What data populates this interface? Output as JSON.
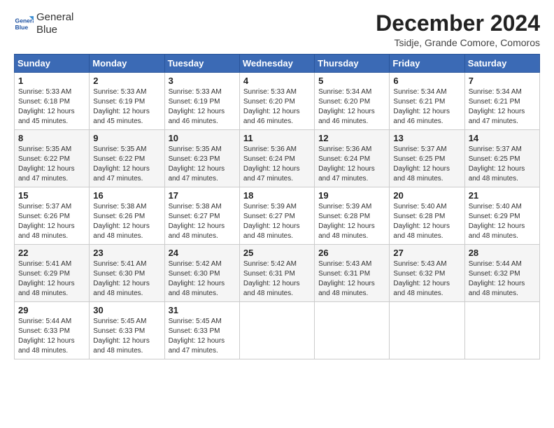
{
  "logo": {
    "line1": "General",
    "line2": "Blue"
  },
  "title": "December 2024",
  "subtitle": "Tsidje, Grande Comore, Comoros",
  "days_header": [
    "Sunday",
    "Monday",
    "Tuesday",
    "Wednesday",
    "Thursday",
    "Friday",
    "Saturday"
  ],
  "weeks": [
    [
      {
        "day": "1",
        "sunrise": "5:33 AM",
        "sunset": "6:18 PM",
        "daylight": "12 hours and 45 minutes."
      },
      {
        "day": "2",
        "sunrise": "5:33 AM",
        "sunset": "6:19 PM",
        "daylight": "12 hours and 45 minutes."
      },
      {
        "day": "3",
        "sunrise": "5:33 AM",
        "sunset": "6:19 PM",
        "daylight": "12 hours and 46 minutes."
      },
      {
        "day": "4",
        "sunrise": "5:33 AM",
        "sunset": "6:20 PM",
        "daylight": "12 hours and 46 minutes."
      },
      {
        "day": "5",
        "sunrise": "5:34 AM",
        "sunset": "6:20 PM",
        "daylight": "12 hours and 46 minutes."
      },
      {
        "day": "6",
        "sunrise": "5:34 AM",
        "sunset": "6:21 PM",
        "daylight": "12 hours and 46 minutes."
      },
      {
        "day": "7",
        "sunrise": "5:34 AM",
        "sunset": "6:21 PM",
        "daylight": "12 hours and 47 minutes."
      }
    ],
    [
      {
        "day": "8",
        "sunrise": "5:35 AM",
        "sunset": "6:22 PM",
        "daylight": "12 hours and 47 minutes."
      },
      {
        "day": "9",
        "sunrise": "5:35 AM",
        "sunset": "6:22 PM",
        "daylight": "12 hours and 47 minutes."
      },
      {
        "day": "10",
        "sunrise": "5:35 AM",
        "sunset": "6:23 PM",
        "daylight": "12 hours and 47 minutes."
      },
      {
        "day": "11",
        "sunrise": "5:36 AM",
        "sunset": "6:24 PM",
        "daylight": "12 hours and 47 minutes."
      },
      {
        "day": "12",
        "sunrise": "5:36 AM",
        "sunset": "6:24 PM",
        "daylight": "12 hours and 47 minutes."
      },
      {
        "day": "13",
        "sunrise": "5:37 AM",
        "sunset": "6:25 PM",
        "daylight": "12 hours and 48 minutes."
      },
      {
        "day": "14",
        "sunrise": "5:37 AM",
        "sunset": "6:25 PM",
        "daylight": "12 hours and 48 minutes."
      }
    ],
    [
      {
        "day": "15",
        "sunrise": "5:37 AM",
        "sunset": "6:26 PM",
        "daylight": "12 hours and 48 minutes."
      },
      {
        "day": "16",
        "sunrise": "5:38 AM",
        "sunset": "6:26 PM",
        "daylight": "12 hours and 48 minutes."
      },
      {
        "day": "17",
        "sunrise": "5:38 AM",
        "sunset": "6:27 PM",
        "daylight": "12 hours and 48 minutes."
      },
      {
        "day": "18",
        "sunrise": "5:39 AM",
        "sunset": "6:27 PM",
        "daylight": "12 hours and 48 minutes."
      },
      {
        "day": "19",
        "sunrise": "5:39 AM",
        "sunset": "6:28 PM",
        "daylight": "12 hours and 48 minutes."
      },
      {
        "day": "20",
        "sunrise": "5:40 AM",
        "sunset": "6:28 PM",
        "daylight": "12 hours and 48 minutes."
      },
      {
        "day": "21",
        "sunrise": "5:40 AM",
        "sunset": "6:29 PM",
        "daylight": "12 hours and 48 minutes."
      }
    ],
    [
      {
        "day": "22",
        "sunrise": "5:41 AM",
        "sunset": "6:29 PM",
        "daylight": "12 hours and 48 minutes."
      },
      {
        "day": "23",
        "sunrise": "5:41 AM",
        "sunset": "6:30 PM",
        "daylight": "12 hours and 48 minutes."
      },
      {
        "day": "24",
        "sunrise": "5:42 AM",
        "sunset": "6:30 PM",
        "daylight": "12 hours and 48 minutes."
      },
      {
        "day": "25",
        "sunrise": "5:42 AM",
        "sunset": "6:31 PM",
        "daylight": "12 hours and 48 minutes."
      },
      {
        "day": "26",
        "sunrise": "5:43 AM",
        "sunset": "6:31 PM",
        "daylight": "12 hours and 48 minutes."
      },
      {
        "day": "27",
        "sunrise": "5:43 AM",
        "sunset": "6:32 PM",
        "daylight": "12 hours and 48 minutes."
      },
      {
        "day": "28",
        "sunrise": "5:44 AM",
        "sunset": "6:32 PM",
        "daylight": "12 hours and 48 minutes."
      }
    ],
    [
      {
        "day": "29",
        "sunrise": "5:44 AM",
        "sunset": "6:33 PM",
        "daylight": "12 hours and 48 minutes."
      },
      {
        "day": "30",
        "sunrise": "5:45 AM",
        "sunset": "6:33 PM",
        "daylight": "12 hours and 48 minutes."
      },
      {
        "day": "31",
        "sunrise": "5:45 AM",
        "sunset": "6:33 PM",
        "daylight": "12 hours and 47 minutes."
      },
      null,
      null,
      null,
      null
    ]
  ]
}
